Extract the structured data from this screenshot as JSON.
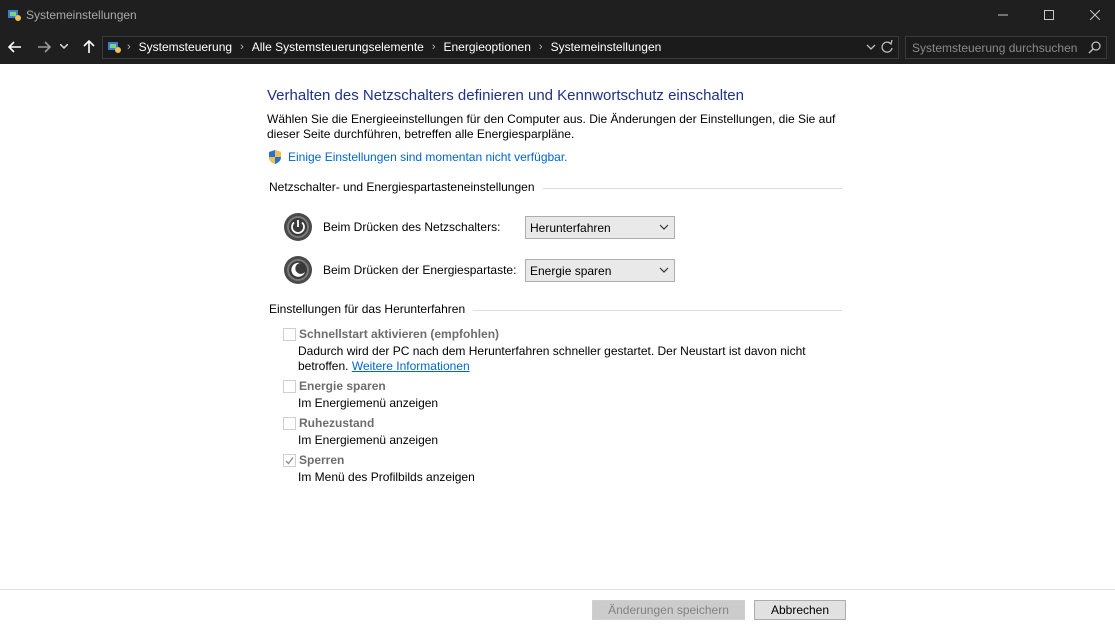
{
  "window": {
    "title": "Systemeinstellungen",
    "minimize_label": "—",
    "maximize_label": "☐",
    "close_label": "✕"
  },
  "address_bar": {
    "breadcrumbs": [
      "Systemsteuerung",
      "Alle Systemsteuerungselemente",
      "Energieoptionen",
      "Systemeinstellungen"
    ],
    "search_placeholder": "Systemsteuerung durchsuchen"
  },
  "main": {
    "heading": "Verhalten des Netzschalters definieren und Kennwortschutz einschalten",
    "description": "Wählen Sie die Energieeinstellungen für den Computer aus. Die Änderungen der Einstellungen, die Sie auf dieser Seite durchführen, betreffen alle Energiesparpläne.",
    "admin_link": "Einige Einstellungen sind momentan nicht verfügbar.",
    "power_section": {
      "title": "Netzschalter- und Energiespartasteneinstellungen",
      "rows": [
        {
          "label": "Beim Drücken des Netzschalters:",
          "value": "Herunterfahren"
        },
        {
          "label": "Beim Drücken der Energiespartaste:",
          "value": "Energie sparen"
        }
      ]
    },
    "shutdown_section": {
      "title": "Einstellungen für das Herunterfahren",
      "options": [
        {
          "title": "Schnellstart aktivieren (empfohlen)",
          "subtitle": "Dadurch wird der PC nach dem Herunterfahren schneller gestartet. Der Neustart ist davon nicht betroffen.",
          "link": "Weitere Informationen",
          "checked": false
        },
        {
          "title": "Energie sparen",
          "subtitle": "Im Energiemenü anzeigen",
          "checked": false
        },
        {
          "title": "Ruhezustand",
          "subtitle": "Im Energiemenü anzeigen",
          "checked": false
        },
        {
          "title": "Sperren",
          "subtitle": "Im Menü des Profilbilds anzeigen",
          "checked": true
        }
      ]
    }
  },
  "footer": {
    "save_label": "Änderungen speichern",
    "cancel_label": "Abbrechen"
  }
}
